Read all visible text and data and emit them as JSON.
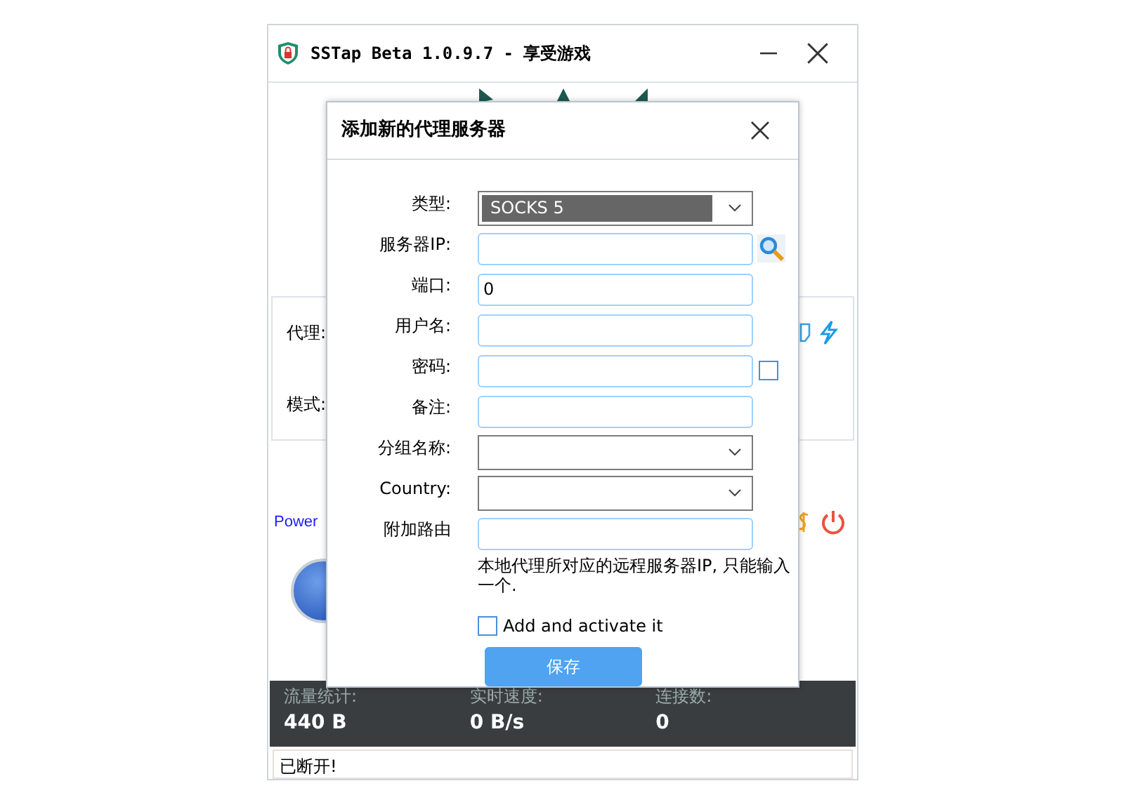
{
  "window": {
    "title": "SSTap Beta 1.0.9.7 - 享受游戏"
  },
  "main": {
    "proxy_label": "代理:",
    "mode_label": "模式:",
    "power_text": "Power",
    "stats": [
      {
        "label": "流量统计:",
        "value": "440 B"
      },
      {
        "label": "实时速度:",
        "value": "0 B/s"
      },
      {
        "label": "连接数:",
        "value": "0"
      }
    ],
    "status": "已断开!"
  },
  "dialog": {
    "title": "添加新的代理服务器",
    "fields": [
      {
        "label": "类型:",
        "kind": "select",
        "value": "SOCKS 5"
      },
      {
        "label": "服务器IP:",
        "kind": "lookup"
      },
      {
        "label": "端口:",
        "kind": "text",
        "value": "0"
      },
      {
        "label": "用户名:",
        "kind": "text"
      },
      {
        "label": "密码:",
        "kind": "secret",
        "checked": false
      },
      {
        "label": "备注:",
        "kind": "text"
      },
      {
        "label": "分组名称:",
        "kind": "select"
      },
      {
        "label": "Country:",
        "kind": "select"
      },
      {
        "label": "附加路由",
        "kind": "text"
      }
    ],
    "hint": "本地代理所对应的远程服务器IP, 只能输入一个.",
    "activate": {
      "label": "Add and activate it",
      "checked": false
    },
    "save": "保存"
  }
}
